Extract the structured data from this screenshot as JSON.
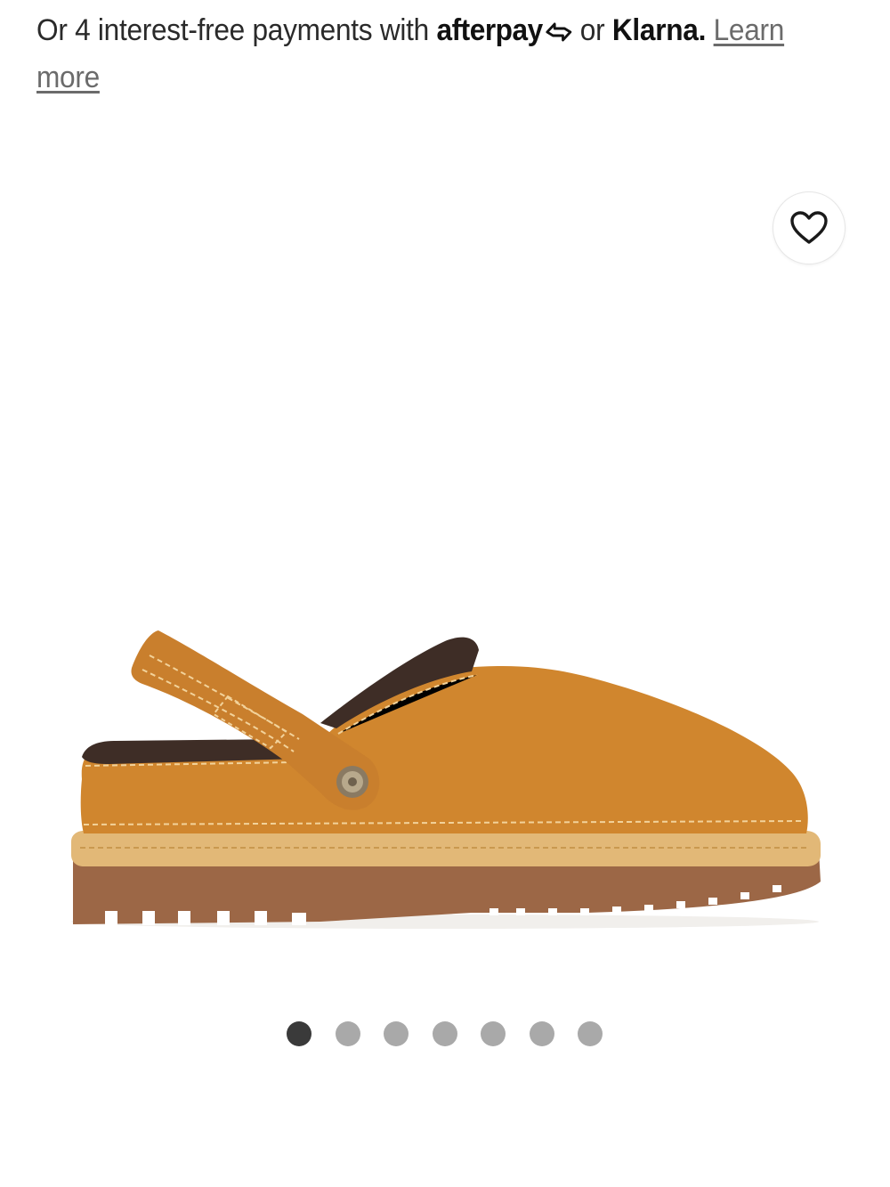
{
  "payments": {
    "prefix": "Or 4 interest-free payments with",
    "afterpay_logo": "afterpay",
    "connector": "or",
    "klarna_logo": "Klarna.",
    "learn_more": "Learn more"
  },
  "wishlist": {
    "icon": "heart-icon"
  },
  "product_image": {
    "subject": "tan nubuck slingback clog with brown collar and lug sole",
    "colors": {
      "upper": "#D0862E",
      "collar": "#3E2D26",
      "midsole": "#E2B877",
      "outsole": "#9A6646"
    }
  },
  "carousel": {
    "total": 7,
    "active_index": 0
  }
}
